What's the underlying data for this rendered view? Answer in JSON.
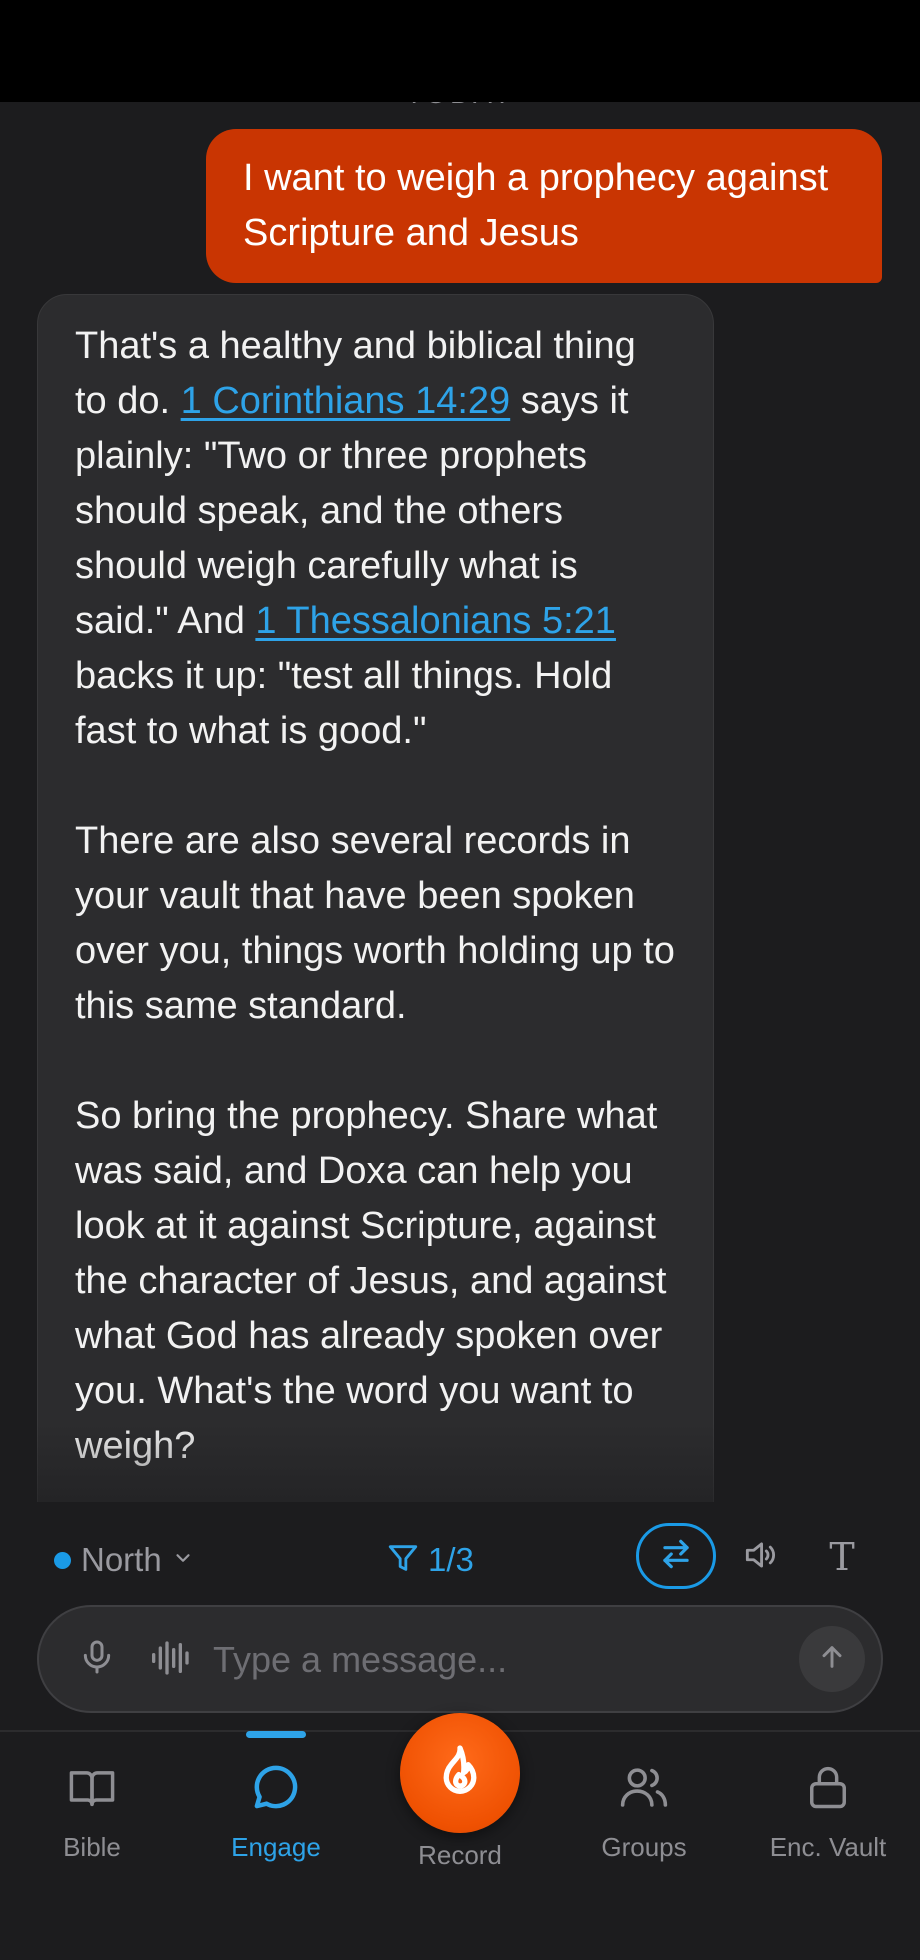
{
  "chat": {
    "date_separator": "TODAY",
    "user_message": "I want to weigh a prophecy against Scripture and Jesus",
    "assistant": {
      "p1_before_ref1": "That's a healthy and biblical thing to do. ",
      "ref1": "1 Corinthians 14:29",
      "p1_between": " says it plainly: \"Two or three prophets should speak, and the others should weigh carefully what is said.\" And ",
      "ref2": "1 Thessalonians 5:21",
      "p1_after_ref2": " backs it up: \"test all things. Hold fast to what is good.\"",
      "p2": "There are also several records in your vault that have been spoken over you, things worth holding up to this same standard.",
      "p3": "So bring the prophecy. Share what was said, and Doxa can help you look at it against Scripture, against the character of Jesus, and against what God has already spoken over you. What's the word you want to weigh?"
    }
  },
  "controls": {
    "direction_label": "North",
    "filter_count": "1/3",
    "swap_icon": "swap-arrows-icon",
    "speaker_icon": "speaker-icon",
    "text_size_glyph": "T"
  },
  "composer": {
    "placeholder": "Type a message..."
  },
  "tabs": [
    {
      "label": "Bible",
      "icon": "book-icon"
    },
    {
      "label": "Engage",
      "icon": "chat-bubble-icon",
      "active": true
    },
    {
      "label": "Record",
      "icon": "flame-icon"
    },
    {
      "label": "Groups",
      "icon": "users-icon"
    },
    {
      "label": "Enc. Vault",
      "icon": "lock-icon"
    }
  ],
  "colors": {
    "accent_blue": "#2ea3e8",
    "user_bubble": "#c93502",
    "record_orange": "#ef5102",
    "background": "#1c1c1e",
    "bubble_bg": "#2c2c2e"
  }
}
